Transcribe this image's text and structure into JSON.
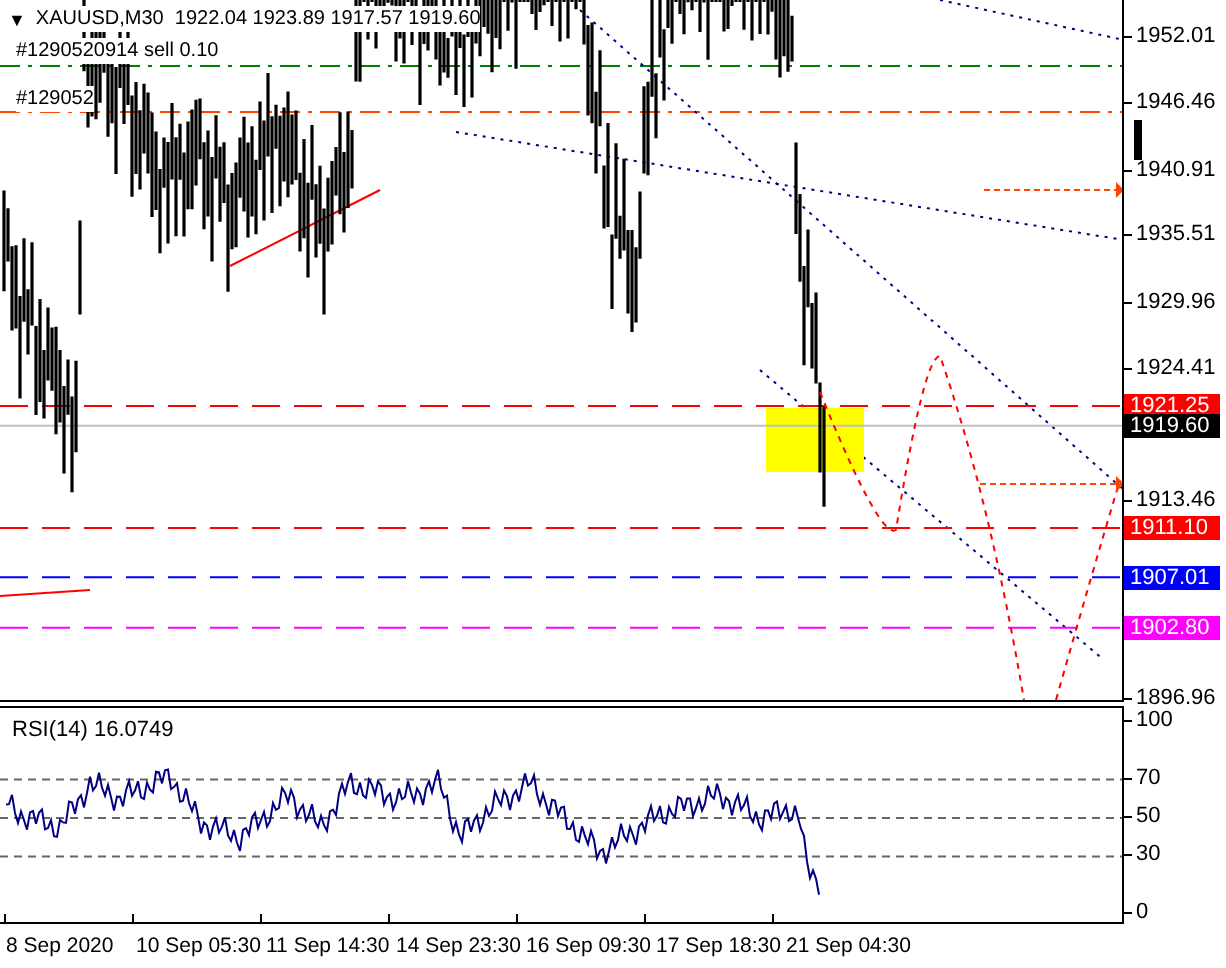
{
  "chart_header": {
    "glyph": "▼",
    "text": "XAUUSD,M30  1922.04 1923.89 1917.57 1919.60"
  },
  "orders": [
    "#1290520914 sell 0.10",
    "#129052"
  ],
  "price_axis": [
    "1952.01",
    "1946.46",
    "1940.91",
    "1935.51",
    "1929.96",
    "1924.41",
    "1913.46",
    "1896.96"
  ],
  "price_badges": [
    {
      "text": "1921.25",
      "color": "#ff0000",
      "kind": "level"
    },
    {
      "text": "1919.60",
      "color": "#000000",
      "kind": "bid"
    },
    {
      "text": "1911.10",
      "color": "#ff0000",
      "kind": "level"
    },
    {
      "text": "1907.01",
      "color": "#0000ff",
      "kind": "level"
    },
    {
      "text": "1902.80",
      "color": "#ff00ff",
      "kind": "level"
    }
  ],
  "rsi": {
    "label": "RSI(14) 16.0749",
    "axis": [
      "100",
      "70",
      "50",
      "30",
      "0"
    ]
  },
  "time_axis": [
    "8 Sep 2020",
    "10 Sep 05:30",
    "11 Sep 14:30",
    "14 Sep 23:30",
    "16 Sep 09:30",
    "17 Sep 18:30",
    "21 Sep 04:30"
  ]
}
